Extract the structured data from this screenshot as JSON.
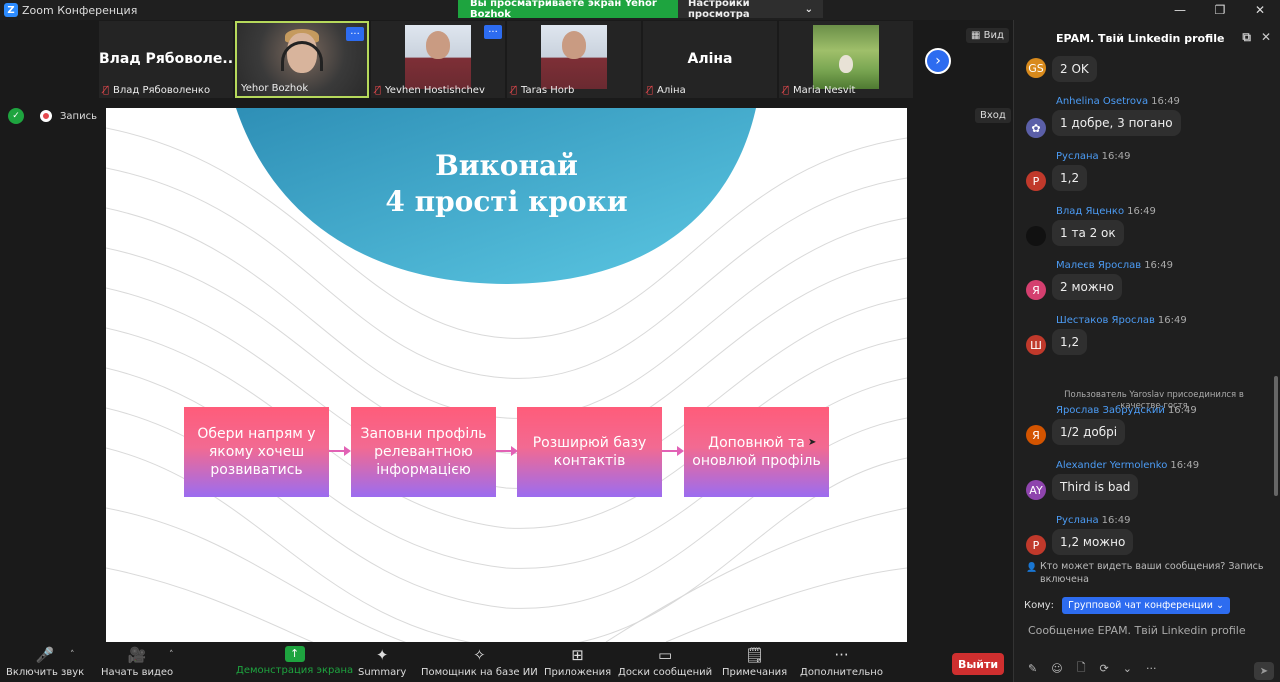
{
  "window": {
    "title": "Zoom Конференция",
    "logo": "Z",
    "share_banner": "Вы просматриваете экран Yehor Bozhok",
    "view_settings": "Настройки просмотра"
  },
  "participants": [
    {
      "big_name": "Влад  Рябоволе...",
      "label": "Влад Рябоволенко",
      "muted": true
    },
    {
      "big_name": "",
      "label": "Yehor Bozhok",
      "muted": false,
      "active": true
    },
    {
      "big_name": "",
      "label": "Yevhen Hostishchev",
      "muted": true
    },
    {
      "big_name": "",
      "label": "Taras Horb",
      "muted": true
    },
    {
      "big_name": "Аліна",
      "label": "Аліна",
      "muted": true
    },
    {
      "big_name": "",
      "label": "Maria Nesvit",
      "muted": true
    }
  ],
  "strip": {
    "view_label": "Вид",
    "more_glyph": "···"
  },
  "subbar": {
    "record_label": "Запись",
    "enter_label": "Вход"
  },
  "slide": {
    "title_line1": "Виконай",
    "title_line2": "4 прості кроки",
    "steps": [
      "Обери напрям у якому хочеш розвиватись",
      "Заповни профіль релевантною інформацією",
      "Розширюй базу контактів",
      "Доповнюй та оновлюй профіль"
    ]
  },
  "chat": {
    "title": "EPAM. Твій Linkedin profile",
    "messages": [
      {
        "initials": "GS",
        "color": "#d88a1c",
        "sender": "",
        "time": "",
        "text": "2 OK"
      },
      {
        "initials": "✿",
        "color": "#5b5fa8",
        "sender": "Anhelina Osetrova",
        "time": "16:49",
        "text": "1 добре, 3 погано"
      },
      {
        "initials": "Р",
        "color": "#c0392b",
        "sender": "Руслана",
        "time": "16:49",
        "text": "1,2"
      },
      {
        "initials": "",
        "color": "#111111",
        "sender": "Влад Яценко",
        "time": "16:49",
        "text": "1 та 2 ок"
      },
      {
        "initials": "Я",
        "color": "#d43f6f",
        "sender": "Малеєв Ярослав",
        "time": "16:49",
        "text": "2 можно"
      },
      {
        "initials": "Ш",
        "color": "#c0392b",
        "sender": "Шестаков Ярослав",
        "time": "16:49",
        "text": "1,2"
      },
      {
        "initials": "Я",
        "color": "#d35400",
        "sender": "Ярослав Забрудский",
        "time": "16:49",
        "text": "1/2 добрі"
      },
      {
        "initials": "AY",
        "color": "#8e44ad",
        "sender": "Alexander Yermolenko",
        "time": "16:49",
        "text": "Third is bad"
      },
      {
        "initials": "Р",
        "color": "#c0392b",
        "sender": "Руслана",
        "time": "16:49",
        "text": "1,2 можно"
      }
    ],
    "system_message": "Пользователь Yaroslav присоединился в качестве гостя",
    "privacy_note": "Кто может видеть ваши сообщения? Запись включена",
    "to_label": "Кому:",
    "to_value": "Групповой чат конференции",
    "composer_placeholder": "Сообщение EPAM. Твій Linkedin profile"
  },
  "toolbar": {
    "mute": "Включить звук",
    "video": "Начать видео",
    "share": "Демонстрация экрана",
    "summary": "Summary",
    "ai": "Помощник на базе ИИ",
    "apps": "Приложения",
    "whiteboards": "Доски сообщений",
    "notes": "Примечания",
    "more": "Дополнительно",
    "leave": "Выйти"
  },
  "colors": {
    "accent": "#2d6cf0",
    "share_green": "#1ea43f",
    "leave_red": "#cf2f2f",
    "sender_blue": "#4c9cf5"
  }
}
